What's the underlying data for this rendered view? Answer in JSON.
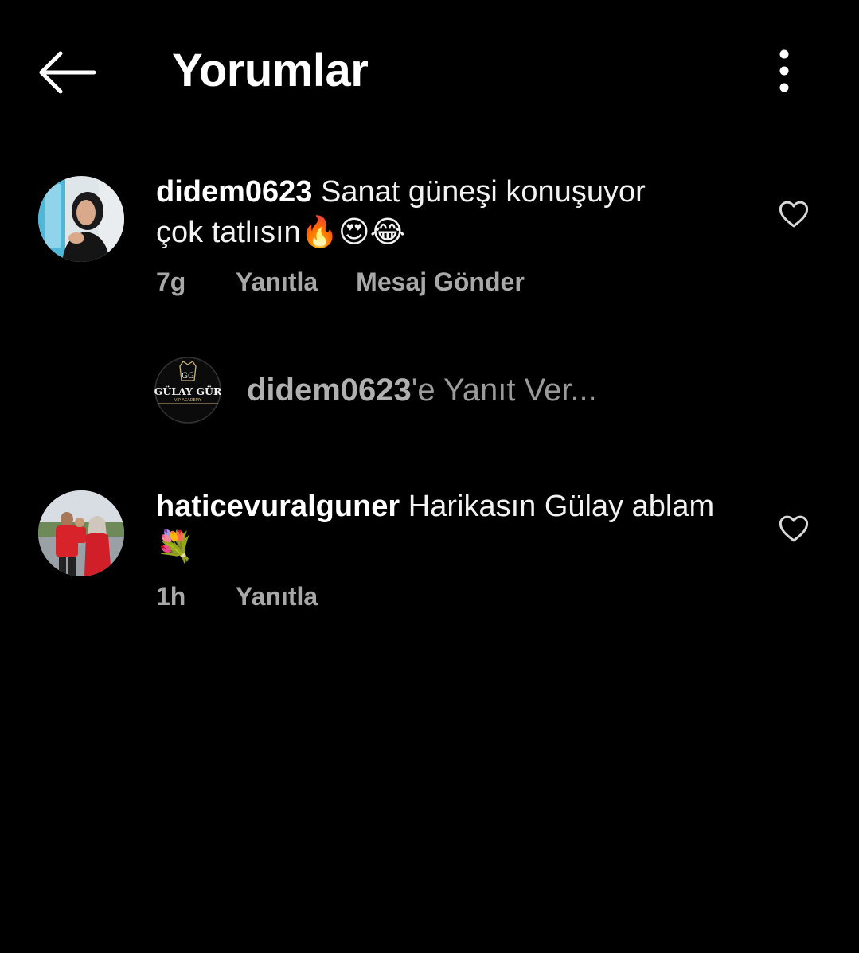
{
  "header": {
    "title": "Yorumlar",
    "back_icon": "arrow-left-icon",
    "menu_icon": "more-vertical-icon"
  },
  "comments": [
    {
      "username": "didem0623",
      "text_line1": "Sanat güneşi konuşuyor",
      "text_line2": "çok tatlısın",
      "emojis": "🔥😍😂",
      "time": "7g",
      "reply_label": "Yanıtla",
      "message_label": "Mesaj Gönder",
      "like_icon": "heart-outline-icon"
    },
    {
      "username": "haticevuralguner",
      "text_line1": "Harikasın Gülay ablam",
      "emojis": "💐",
      "time": "1h",
      "reply_label": "Yanıtla",
      "like_icon": "heart-outline-icon"
    }
  ],
  "reply_box": {
    "target_user": "didem0623",
    "suffix": "'e Yanıt Ver...",
    "logo_text": "GÜLAY GÜR",
    "logo_sub": "VIP ACADEMY",
    "logo_monogram": "GG"
  },
  "colors": {
    "background": "#000000",
    "text": "#ffffff",
    "muted": "#a8a8a8"
  }
}
